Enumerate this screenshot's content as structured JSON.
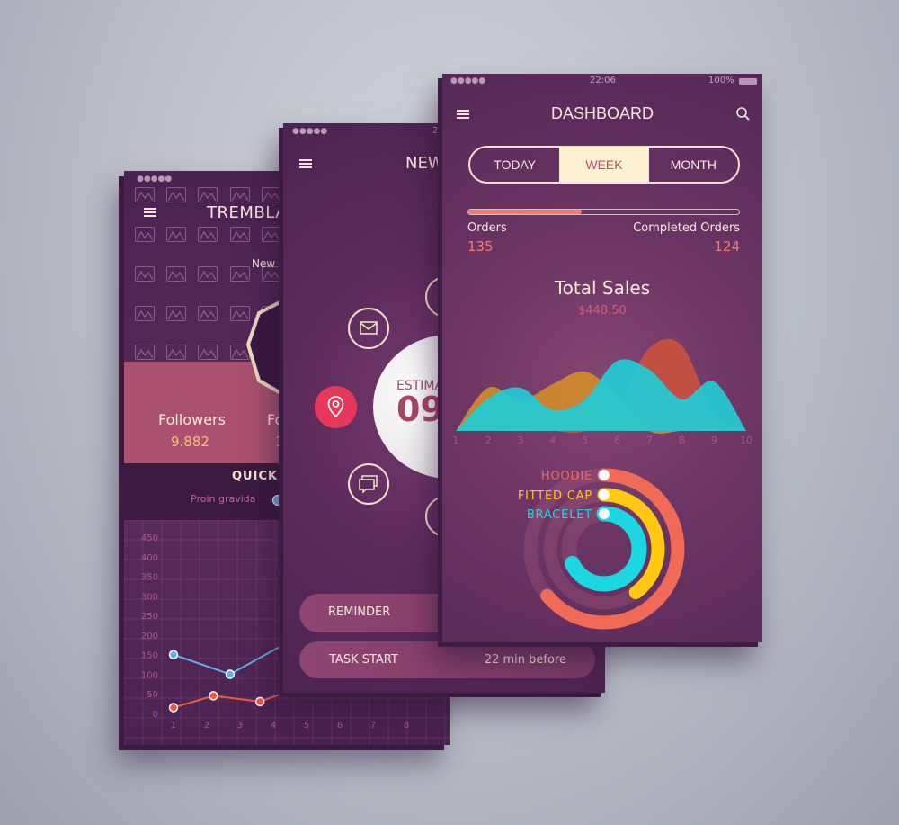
{
  "profile_screen": {
    "status_dots": "●●●●●",
    "title": "TREMBLA",
    "location": "New Y",
    "stats": [
      {
        "label": "Followers",
        "value": "9.882"
      },
      {
        "label": "Fo",
        "value": "1"
      }
    ],
    "quick_title": "QUICK S",
    "legend_label": "Proin gravida",
    "colors": {
      "band": "#a9516f",
      "value": "#f5c26b",
      "blue_series": "#5fb3e6",
      "orange_series": "#f05a3c"
    },
    "chart_data": {
      "type": "line",
      "yticks": [
        0,
        50,
        100,
        150,
        200,
        250,
        300,
        350,
        400,
        450
      ],
      "xticks": [
        1,
        2,
        3,
        4,
        5,
        6,
        7,
        8
      ],
      "ylim": [
        0,
        450
      ],
      "grid": true,
      "series": [
        {
          "color": "#5fb3e6",
          "points": [
            [
              1,
              150
            ],
            [
              2.7,
              100
            ],
            [
              4.3,
              175
            ]
          ]
        },
        {
          "color": "#f05a3c",
          "points": [
            [
              1,
              15
            ],
            [
              2.2,
              45
            ],
            [
              3.6,
              30
            ],
            [
              4.4,
              55
            ]
          ]
        }
      ]
    }
  },
  "task_screen": {
    "status_dots": "●●●●●",
    "status_time": "22",
    "title": "NEW",
    "estimate_label": "ESTIMA",
    "estimate_value": "09",
    "icons": [
      "mail-icon",
      "location-pin-icon",
      "chat-icon"
    ],
    "buttons": [
      {
        "label": "REMINDER"
      },
      {
        "label": "TASK START",
        "value": "22 min before"
      }
    ]
  },
  "dashboard": {
    "status": {
      "dots": "●●●●●",
      "time": "22:06",
      "battery": "100%"
    },
    "title": "DASHBOARD",
    "tabs": [
      {
        "label": "TODAY"
      },
      {
        "label": "WEEK",
        "active": true
      },
      {
        "label": "MONTH"
      }
    ],
    "orders": {
      "label": "Orders",
      "value": "135",
      "completed_label": "Completed Orders",
      "completed_value": "124",
      "progress": 0.42
    },
    "total_sales": {
      "label": "Total Sales",
      "value": "$448.50"
    },
    "colors": {
      "accent": "#f57a6e",
      "active_tab": "#fdf1d4"
    },
    "chart_data": [
      {
        "type": "area",
        "x": [
          1,
          2,
          3,
          4,
          5,
          6,
          7,
          8,
          9,
          10
        ],
        "xticks": [
          "1",
          "2",
          "3",
          "4",
          "5",
          "6",
          "7",
          "8",
          "9",
          "10"
        ],
        "series": [
          {
            "color": "#c8513f",
            "values": [
              0,
              0,
              0,
              0,
              0,
              30,
              92,
              95,
              20,
              0
            ]
          },
          {
            "color": "#d08a2c",
            "values": [
              0,
              48,
              34,
              52,
              66,
              40,
              0,
              0,
              0,
              0
            ]
          },
          {
            "color": "#22ccd6",
            "values": [
              0,
              36,
              48,
              23,
              35,
              78,
              68,
              35,
              55,
              0
            ]
          }
        ]
      },
      {
        "type": "radial-bar",
        "series": [
          {
            "name": "HOODIE",
            "value": 0.64,
            "color": "#f06a58"
          },
          {
            "name": "FITTED CAP",
            "value": 0.4,
            "color": "#ffc812"
          },
          {
            "name": "BRACELET",
            "value": 0.68,
            "color": "#1ed6e2"
          }
        ]
      }
    ]
  }
}
